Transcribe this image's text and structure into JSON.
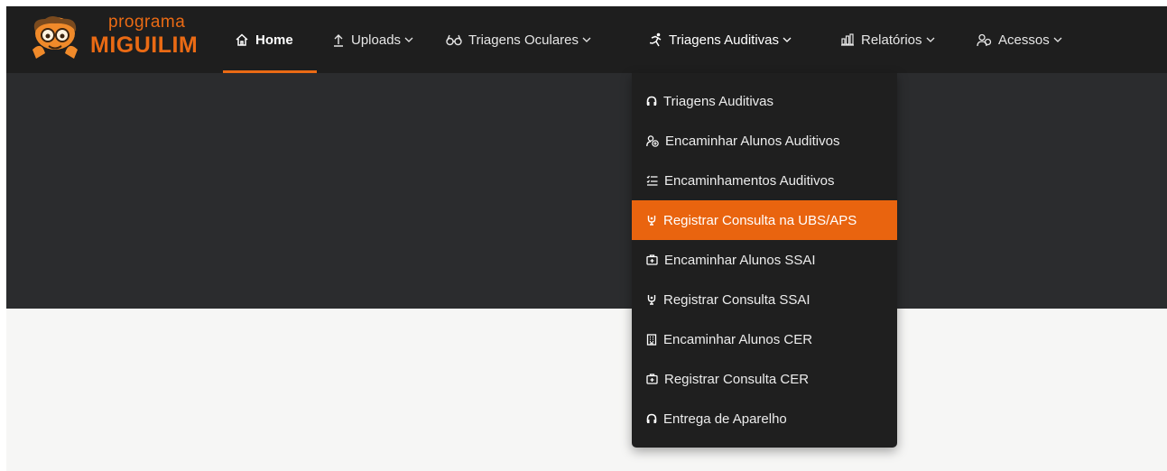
{
  "brand": {
    "small": "programa",
    "big": "MIGUILIM"
  },
  "nav": [
    {
      "label": "Home",
      "icon": "home-icon"
    },
    {
      "label": "Uploads",
      "icon": "upload-icon"
    },
    {
      "label": "Triagens Oculares",
      "icon": "glasses-icon"
    },
    {
      "label": "Triagens Auditivas",
      "icon": "run-icon"
    },
    {
      "label": "Relatórios",
      "icon": "chart-icon"
    },
    {
      "label": "Acessos",
      "icon": "users-icon"
    }
  ],
  "dropdown": {
    "items": [
      {
        "label": "Triagens Auditivas",
        "icon": "headphones-icon"
      },
      {
        "label": "Encaminhar Alunos Auditivos",
        "icon": "user-add-icon"
      },
      {
        "label": "Encaminhamentos Auditivos",
        "icon": "list-icon"
      },
      {
        "label": "Registrar Consulta na UBS/APS",
        "icon": "stethoscope-icon"
      },
      {
        "label": "Encaminhar Alunos SSAI",
        "icon": "medical-box-icon"
      },
      {
        "label": "Registrar Consulta SSAI",
        "icon": "stethoscope-icon"
      },
      {
        "label": "Encaminhar Alunos CER",
        "icon": "building-icon"
      },
      {
        "label": "Registrar Consulta CER",
        "icon": "medical-box-icon"
      },
      {
        "label": "Entrega de Aparelho",
        "icon": "headphones-icon"
      }
    ],
    "highlighted_index": 3
  },
  "colors": {
    "accent": "#ea6a14",
    "navbar": "#1e1e1e",
    "hero": "#2b2c2e",
    "dropdown": "#1f1f1f",
    "page": "#f6f6f5"
  }
}
